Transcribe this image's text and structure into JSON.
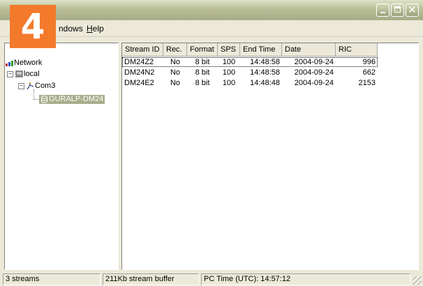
{
  "badge": "4",
  "menu": {
    "windows": "Windows",
    "windows_visible": "ndows",
    "help": "Help"
  },
  "tree": {
    "network": "Network",
    "local": "local",
    "com": "Com3",
    "device": "GURALP-DM24"
  },
  "table": {
    "columns": [
      "Stream ID",
      "Rec.",
      "Format",
      "SPS",
      "End Time",
      "Date",
      "RIC"
    ],
    "rows": [
      {
        "stream_id": "DM24Z2",
        "rec": "No",
        "format": "8 bit",
        "sps": "100",
        "end_time": "14:48:58",
        "date": "2004-09-24",
        "ric": "996"
      },
      {
        "stream_id": "DM24N2",
        "rec": "No",
        "format": "8 bit",
        "sps": "100",
        "end_time": "14:48:58",
        "date": "2004-09-24",
        "ric": "662"
      },
      {
        "stream_id": "DM24E2",
        "rec": "No",
        "format": "8 bit",
        "sps": "100",
        "end_time": "14:48:48",
        "date": "2004-09-24",
        "ric": "2153"
      }
    ]
  },
  "status": {
    "streams": "3 streams",
    "buffer": "211Kb stream buffer",
    "pc_time": "PC Time (UTC):  14:57:12"
  },
  "colors": {
    "accent": "#f3792b",
    "selection": "#a8ad8c",
    "titlebar": "#b8bd98"
  }
}
